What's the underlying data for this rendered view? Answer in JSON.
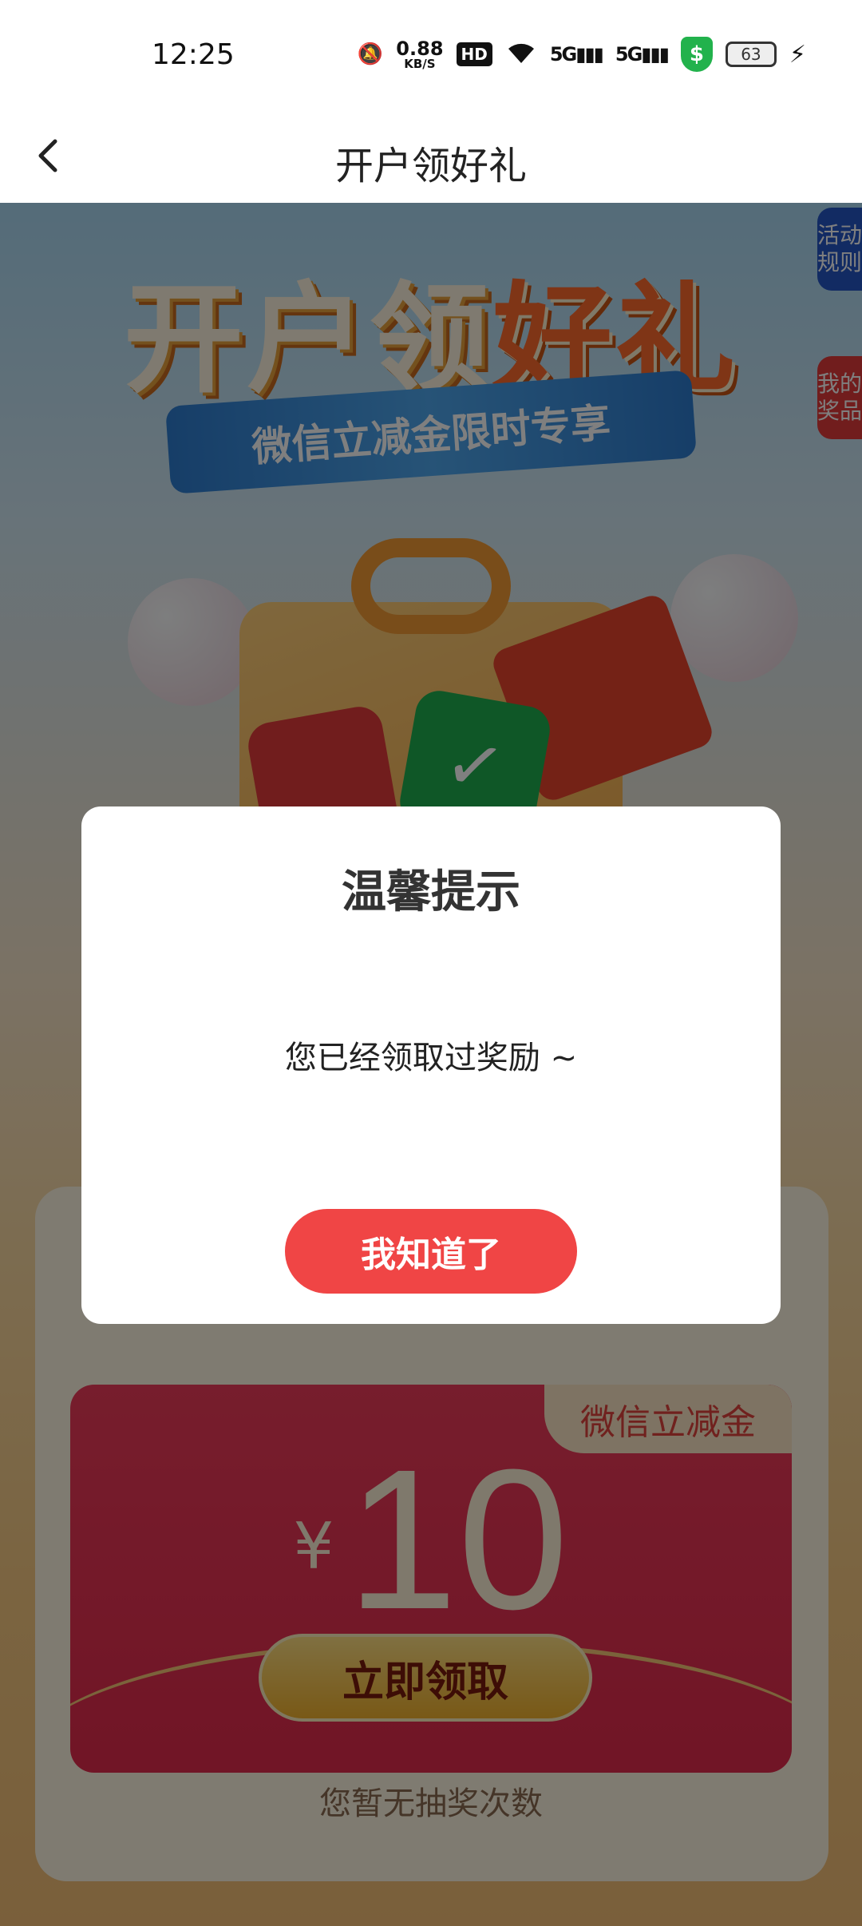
{
  "status_bar": {
    "time": "12:25",
    "net_speed_value": "0.88",
    "net_speed_unit": "KB/S",
    "hd_label": "HD",
    "signal1": "5G",
    "signal2": "5G",
    "battery": "63"
  },
  "header": {
    "back_icon": "chevron-left-icon",
    "title": "开户领好礼"
  },
  "banner": {
    "title_part1": "开户领",
    "title_part2": "好礼",
    "subtitle": "微信立减金限时专享"
  },
  "side_tabs": {
    "rules": "活动规则",
    "prizes": "我的奖品"
  },
  "coupon": {
    "tag": "微信立减金",
    "currency": "¥",
    "amount": "10",
    "claim_label": "立即领取",
    "no_draw_text": "您暂无抽奖次数"
  },
  "dialog": {
    "title": "温馨提示",
    "message": "您已经领取过奖励 ~",
    "confirm_label": "我知道了"
  },
  "colors": {
    "accent_red": "#f04545",
    "coupon_red": "#e22a4c",
    "rules_tab": "#2556c7",
    "prizes_tab": "#e23a3a",
    "shield_green": "#22b24c"
  }
}
